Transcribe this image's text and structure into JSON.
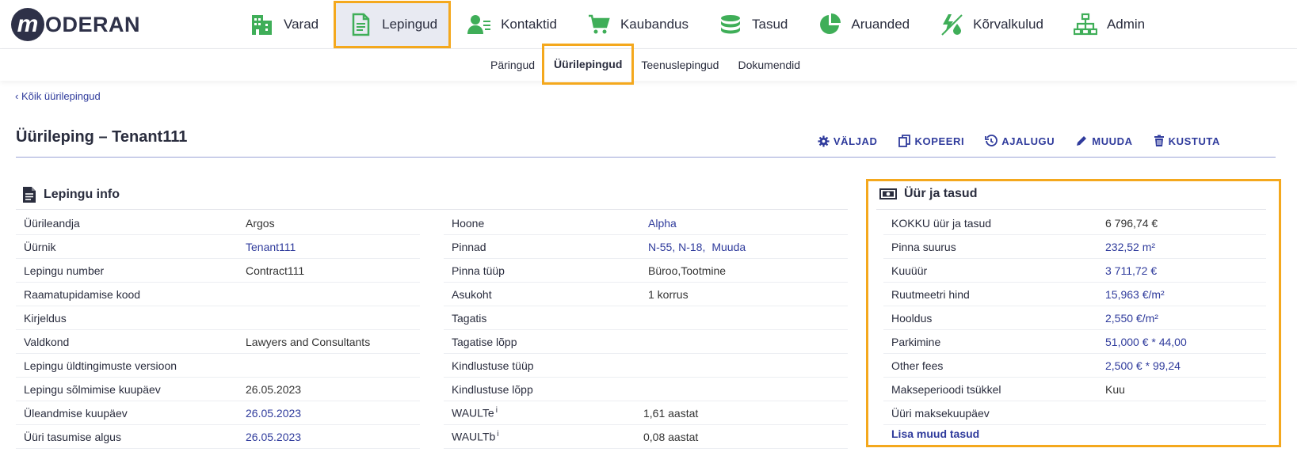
{
  "logo": {
    "m": "m",
    "text": "ODERAN"
  },
  "mainnav": [
    {
      "label": "Varad"
    },
    {
      "label": "Lepingud"
    },
    {
      "label": "Kontaktid"
    },
    {
      "label": "Kaubandus"
    },
    {
      "label": "Tasud"
    },
    {
      "label": "Aruanded"
    },
    {
      "label": "Kõrvalkulud"
    },
    {
      "label": "Admin"
    }
  ],
  "subnav": [
    {
      "label": "Päringud"
    },
    {
      "label": "Üürilepingud"
    },
    {
      "label": "Teenuslepingud"
    },
    {
      "label": "Dokumendid"
    }
  ],
  "back_link": "Kõik üürilepingud",
  "title": "Üürileping – Tenant111",
  "actions": {
    "fields": "VÄLJAD",
    "copy": "KOPEERI",
    "history": "AJALUGU",
    "edit": "MUUDA",
    "delete": "KUSTUTA"
  },
  "contract_info": {
    "heading": "Lepingu info",
    "left": [
      {
        "k": "Üürileandja",
        "v": "Argos"
      },
      {
        "k": "Üürnik",
        "v": "Tenant111"
      },
      {
        "k": "Lepingu number",
        "v": "Contract111"
      },
      {
        "k": "Raamatupidamise kood",
        "v": ""
      },
      {
        "k": "Kirjeldus",
        "v": ""
      },
      {
        "k": "Valdkond",
        "v": "Lawyers and Consultants"
      },
      {
        "k": "Lepingu üldtingimuste versioon",
        "v": ""
      },
      {
        "k": "Lepingu sõlmimise kuupäev",
        "v": "26.05.2023"
      },
      {
        "k": "Üleandmise kuupäev",
        "v": "26.05.2023"
      },
      {
        "k": "Üüri tasumise algus",
        "v": "26.05.2023"
      }
    ],
    "right": [
      {
        "k": "Hoone",
        "v": "Alpha"
      },
      {
        "k": "Pinnad",
        "v": "N-55, N-18,",
        "v2": "Muuda"
      },
      {
        "k": "Pinna tüüp",
        "v": "Büroo,Tootmine"
      },
      {
        "k": "Asukoht",
        "v": "1 korrus"
      },
      {
        "k": "Tagatis",
        "v": ""
      },
      {
        "k": "Tagatise lõpp",
        "v": ""
      },
      {
        "k": "Kindlustuse tüüp",
        "v": ""
      },
      {
        "k": "Kindlustuse lõpp",
        "v": ""
      },
      {
        "k": "WAULTe",
        "sup": "i",
        "v": "1,61 aastat"
      },
      {
        "k": "WAULTb",
        "sup": "i",
        "v": "0,08 aastat"
      }
    ]
  },
  "rent": {
    "heading": "Üür ja tasud",
    "rows": [
      {
        "k": "KOKKU üür ja tasud",
        "v": "6 796,74 €"
      },
      {
        "k": "Pinna suurus",
        "v": "232,52 m²"
      },
      {
        "k": "Kuuüür",
        "v": "3 711,72 €"
      },
      {
        "k": "Ruutmeetri hind",
        "v": "15,963 €/m²"
      },
      {
        "k": "Hooldus",
        "v": "2,550 €/m²"
      },
      {
        "k": "Parkimine",
        "v": "51,000 € * 44,00"
      },
      {
        "k": "Other fees",
        "v": "2,500 € * 99,24"
      },
      {
        "k": "Makseperioodi tsükkel",
        "v": "Kuu"
      },
      {
        "k": "Üüri maksekuupäev",
        "v": ""
      }
    ],
    "add_link": "Lisa muud tasud"
  },
  "colors": {
    "accent": "#f4a81d",
    "green": "#3fae58",
    "link": "#2f3b9c",
    "dark": "#2a2d3e"
  }
}
